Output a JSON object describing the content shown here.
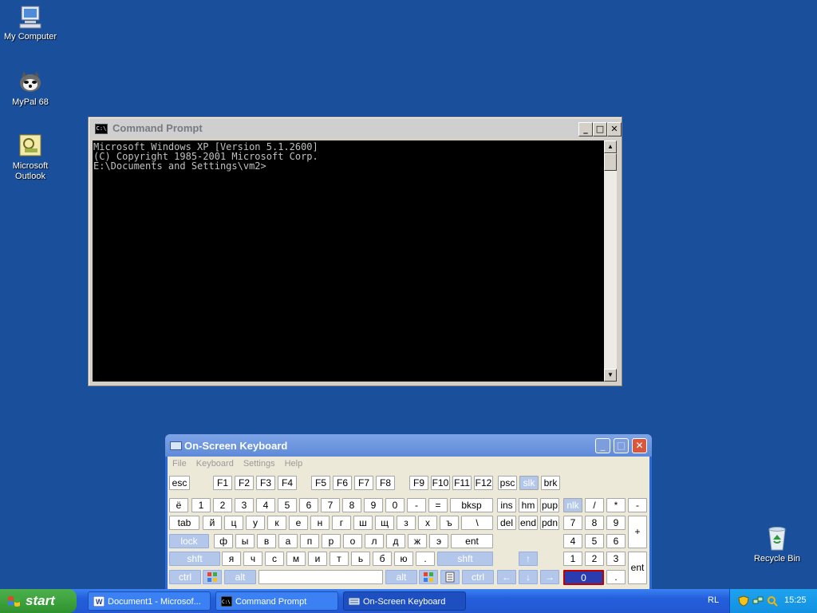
{
  "desktop": {
    "icons": [
      {
        "label": "My Computer"
      },
      {
        "label": "MyPal 68"
      },
      {
        "label": "Microsoft Outlook"
      },
      {
        "label": "Recycle Bin"
      }
    ]
  },
  "cmd_window": {
    "title": "Command Prompt",
    "icon": "C:\\",
    "lines": [
      "Microsoft Windows XP [Version 5.1.2600]",
      "(C) Copyright 1985-2001 Microsoft Corp.",
      "",
      "E:\\Documents and Settings\\vm2>"
    ],
    "buttons": {
      "minimize": "_",
      "maximize": "□",
      "close": "✕"
    }
  },
  "osk_window": {
    "title": "On-Screen Keyboard",
    "menu": [
      "File",
      "Keyboard",
      "Settings",
      "Help"
    ],
    "rows": {
      "fn": [
        "esc",
        "F1",
        "F2",
        "F3",
        "F4",
        "F5",
        "F6",
        "F7",
        "F8",
        "F9",
        "F10",
        "F11",
        "F12",
        "psc",
        "slk",
        "brk"
      ],
      "num": [
        "ё",
        "1",
        "2",
        "3",
        "4",
        "5",
        "6",
        "7",
        "8",
        "9",
        "0",
        "-",
        "=",
        "bksp"
      ],
      "top": [
        "tab",
        "й",
        "ц",
        "у",
        "к",
        "е",
        "н",
        "г",
        "ш",
        "щ",
        "з",
        "х",
        "ъ",
        "\\"
      ],
      "home": [
        "lock",
        "ф",
        "ы",
        "в",
        "а",
        "п",
        "р",
        "о",
        "л",
        "д",
        "ж",
        "э",
        "ent"
      ],
      "bottom": [
        "shft",
        "я",
        "ч",
        "с",
        "м",
        "и",
        "т",
        "ь",
        "б",
        "ю",
        ".",
        "shft"
      ],
      "space": [
        "ctrl",
        "alt",
        "alt",
        "ctrl"
      ],
      "nav": [
        "ins",
        "hm",
        "pup",
        "del",
        "end",
        "pdn"
      ],
      "numpad": [
        "nlk",
        "/",
        "*",
        "-",
        "7",
        "8",
        "9",
        "+",
        "4",
        "5",
        "6",
        "1",
        "2",
        "3",
        "ent",
        "0",
        "."
      ]
    }
  },
  "taskbar": {
    "start_label": "start",
    "tasks": [
      "Document1 - Microsof...",
      "Command Prompt",
      "On-Screen Keyboard"
    ],
    "language": "RL",
    "clock": "15:25"
  }
}
